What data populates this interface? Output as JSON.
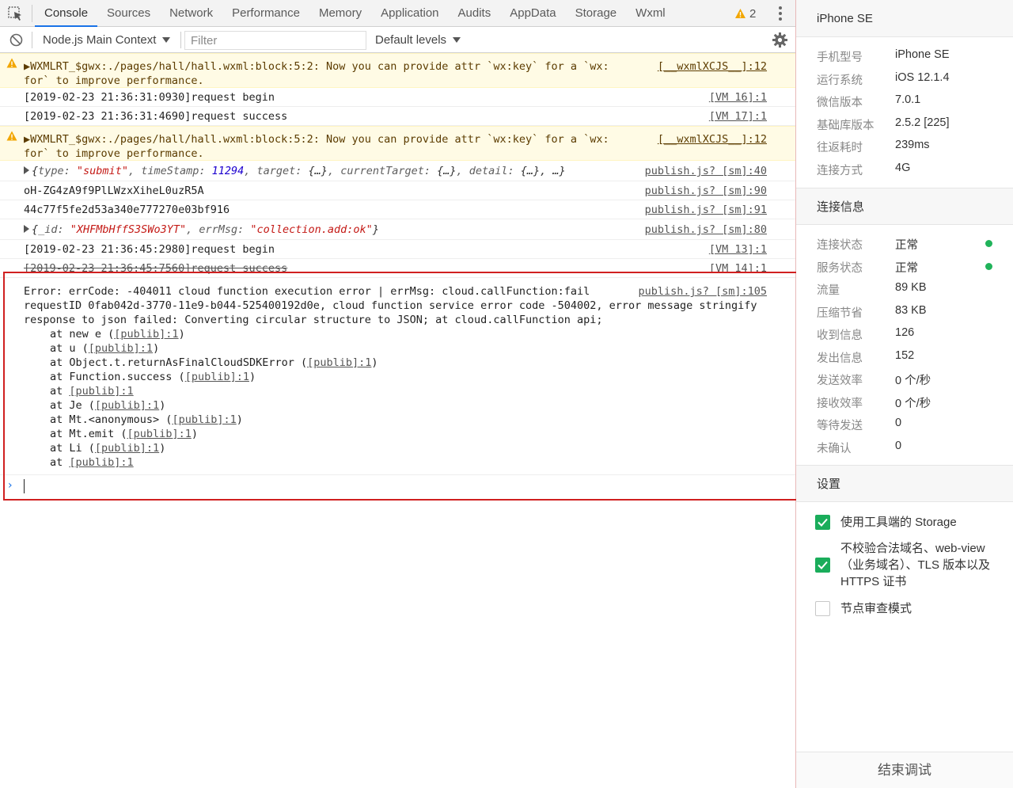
{
  "tabs": [
    "Console",
    "Sources",
    "Network",
    "Performance",
    "Memory",
    "Application",
    "Audits",
    "AppData",
    "Storage",
    "Wxml"
  ],
  "active_tab": "Console",
  "warning_count": "2",
  "toolbar": {
    "context": "Node.js Main Context",
    "filter_placeholder": "Filter",
    "levels": "Default levels"
  },
  "console": {
    "warn1": {
      "text": "▶WXMLRT_$gwx:./pages/hall/hall.wxml:block:5:2: Now you can provide attr `wx:key` for a `wx:for` to improve performance.",
      "src": "[__wxmlXCJS__]:12"
    },
    "log1": {
      "text": "[2019-02-23 21:36:31:0930]request begin",
      "src": "[VM 16]:1"
    },
    "log2": {
      "text": "[2019-02-23 21:36:31:4690]request success",
      "src": "[VM 17]:1"
    },
    "warn2": {
      "text": "▶WXMLRT_$gwx:./pages/hall/hall.wxml:block:5:2: Now you can provide attr `wx:key` for a `wx:for` to improve performance.",
      "src": "[__wxmlXCJS__]:12"
    },
    "obj1": {
      "src": "publish.js? [sm]:40",
      "parts": {
        "open": "{",
        "k1": "type: ",
        "v1": "\"submit\"",
        "k2": ", timeStamp: ",
        "v2": "11294",
        "k3": ", target: ",
        "v3": "{…}",
        "k4": ", currentTarget: ",
        "v4": "{…}",
        "k5": ", detail: ",
        "v5": "{…}",
        "tail": ", …}"
      }
    },
    "log3": {
      "text": "oH-ZG4zA9f9PlLWzxXiheL0uzR5A",
      "src": "publish.js? [sm]:90"
    },
    "log4": {
      "text": "44c77f5fe2d53a340e777270e03bf916",
      "src": "publish.js? [sm]:91"
    },
    "obj2": {
      "src": "publish.js? [sm]:80",
      "parts": {
        "open": "{",
        "k1": "_id: ",
        "v1": "\"XHFMbHffS3SWo3YT\"",
        "k2": ", errMsg: ",
        "v2": "\"collection.add:ok\"",
        "close": "}"
      }
    },
    "log5": {
      "text": "[2019-02-23 21:36:45:2980]request begin",
      "src": "[VM 13]:1"
    },
    "log6": {
      "text": "[2019-02-23 21:36:45:7560]request success",
      "src": "[VM 14]:1"
    },
    "error": {
      "line1": "Error: errCode: -404011 cloud function execution error | errMsg: cloud.callFunction:fail",
      "line2": "requestID 0fab042d-3770-11e9-b044-525400192d0e, cloud function service error code -504002, error message stringify response to json failed: Converting circular structure to JSON; at cloud.callFunction api;",
      "src": "publish.js? [sm]:105",
      "stack": [
        {
          "pre": "at new e (",
          "link": "[publib]:1",
          "post": ")"
        },
        {
          "pre": "at u (",
          "link": "[publib]:1",
          "post": ")"
        },
        {
          "pre": "at Object.t.returnAsFinalCloudSDKError (",
          "link": "[publib]:1",
          "post": ")"
        },
        {
          "pre": "at Function.success (",
          "link": "[publib]:1",
          "post": ")"
        },
        {
          "pre": "at ",
          "link": "[publib]:1",
          "post": ""
        },
        {
          "pre": "at Je (",
          "link": "[publib]:1",
          "post": ")"
        },
        {
          "pre": "at Mt.<anonymous> (",
          "link": "[publib]:1",
          "post": ")"
        },
        {
          "pre": "at Mt.emit (",
          "link": "[publib]:1",
          "post": ")"
        },
        {
          "pre": "at Li (",
          "link": "[publib]:1",
          "post": ")"
        },
        {
          "pre": "at ",
          "link": "[publib]:1",
          "post": ""
        }
      ]
    },
    "prompt": "›"
  },
  "sidepanel": {
    "device": "iPhone SE",
    "device_info": [
      {
        "k": "手机型号",
        "v": "iPhone SE"
      },
      {
        "k": "运行系统",
        "v": "iOS 12.1.4"
      },
      {
        "k": "微信版本",
        "v": "7.0.1"
      },
      {
        "k": "基础库版本",
        "v": "2.5.2 [225]"
      },
      {
        "k": "往返耗时",
        "v": "239ms"
      },
      {
        "k": "连接方式",
        "v": "4G"
      }
    ],
    "connection_title": "连接信息",
    "connection_info": [
      {
        "k": "连接状态",
        "v": "正常",
        "status": true
      },
      {
        "k": "服务状态",
        "v": "正常",
        "status": true
      },
      {
        "k": "流量",
        "v": "89 KB"
      },
      {
        "k": "压缩节省",
        "v": "83 KB"
      },
      {
        "k": "收到信息",
        "v": "126"
      },
      {
        "k": "发出信息",
        "v": "152"
      },
      {
        "k": "发送效率",
        "v": "0 个/秒"
      },
      {
        "k": "接收效率",
        "v": "0 个/秒"
      },
      {
        "k": "等待发送",
        "v": "0"
      },
      {
        "k": "未确认",
        "v": "0"
      }
    ],
    "settings_title": "设置",
    "settings": [
      {
        "label": "使用工具端的 Storage",
        "checked": true
      },
      {
        "label": "不校验合法域名、web-view（业务域名）、TLS 版本以及 HTTPS 证书",
        "checked": true
      },
      {
        "label": "节点审查模式",
        "checked": false
      }
    ],
    "end_debug": "结束调试"
  },
  "colors": {
    "accent": "#1a73e8",
    "warn_bg": "#fffbe5",
    "string": "#c41a16",
    "number": "#1c00cf",
    "status_ok": "#20b35a",
    "checkbox_on": "#1aad5b",
    "highlight": "#d02020"
  }
}
